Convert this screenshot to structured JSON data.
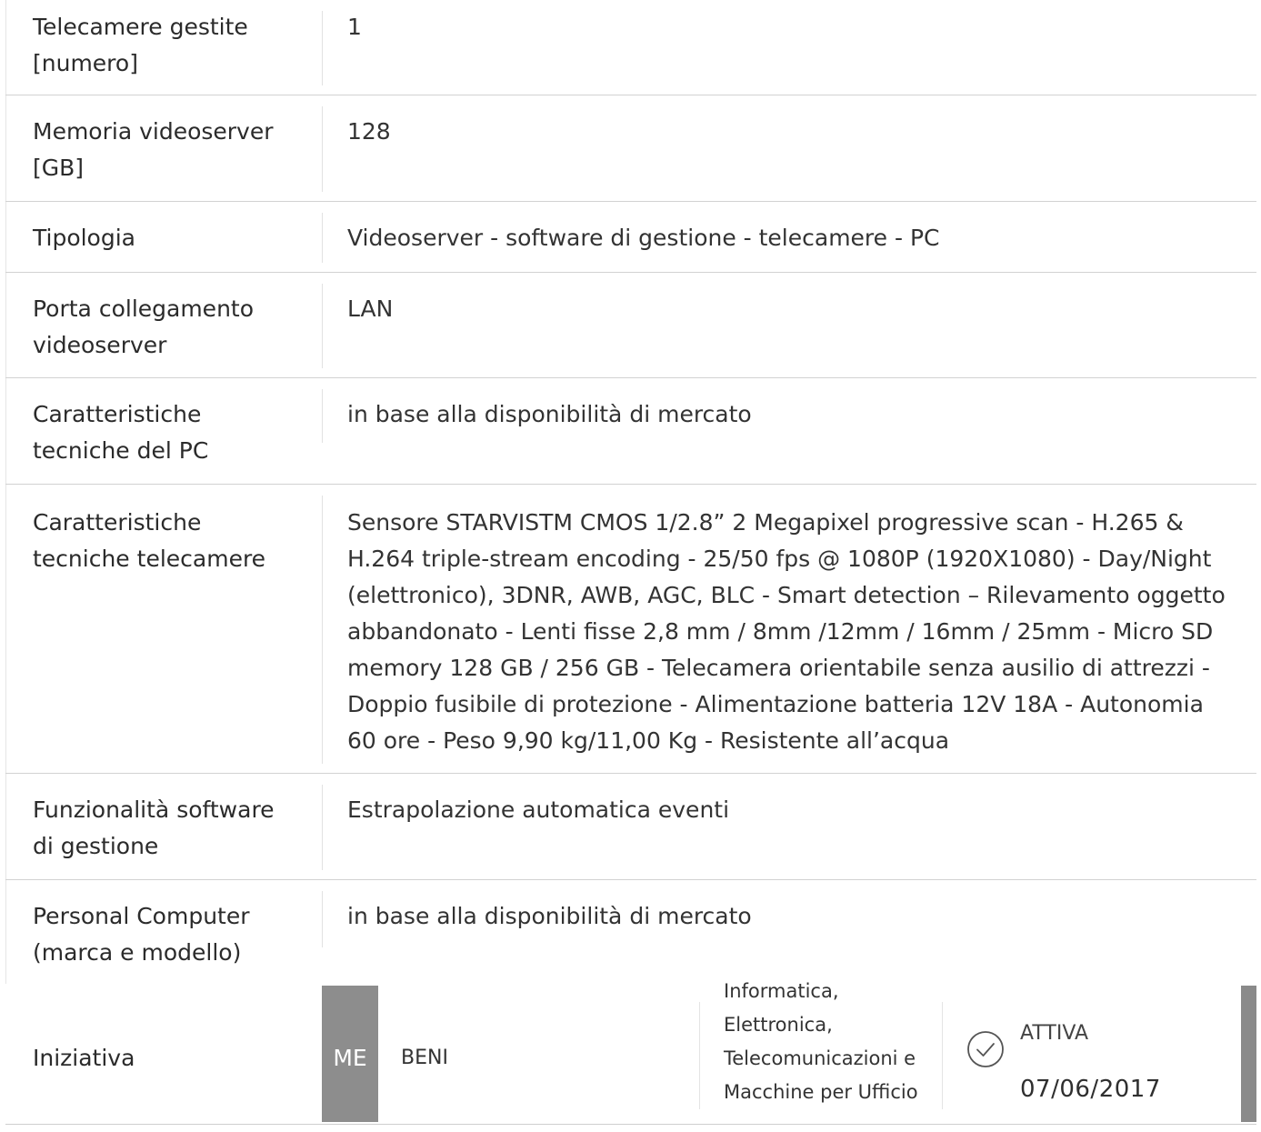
{
  "specs": [
    {
      "label": "Telecamere gestite\n[numero]",
      "value": "1"
    },
    {
      "label": "Memoria videoserver\n[GB]",
      "value": "128"
    },
    {
      "label": "Tipologia",
      "value": "Videoserver - software di gestione - telecamere - PC"
    },
    {
      "label": "Porta collegamento\nvideoserver",
      "value": "LAN"
    },
    {
      "label": "Caratteristiche\ntecniche del PC",
      "value": "in base alla disponibilità di mercato"
    },
    {
      "label": "Caratteristiche\ntecniche telecamere",
      "value": "Sensore STARVISTM CMOS 1/2.8” 2 Megapixel progressive scan - H.265 & H.264 triple-stream encoding - 25/50 fps @ 1080P (1920X1080) - Day/Night (elettronico), 3DNR, AWB, AGC, BLC - Smart detection – Rilevamento oggetto abbandonato - Lenti fisse 2,8 mm / 8mm /12mm / 16mm / 25mm - Micro SD memory 128 GB / 256 GB - Telecamera orientabile senza ausilio di attrezzi - Doppio fusibile di protezione - Alimentazione batteria 12V 18A - Autonomia 60 ore - Peso 9,90 kg/11,00 Kg - Resistente all’acqua"
    },
    {
      "label": "Funzionalità software\ndi gestione",
      "value": "Estrapolazione automatica eventi"
    },
    {
      "label": "Personal Computer\n(marca e modello)",
      "value": "in base alla disponibilità di mercato"
    }
  ],
  "iniziativa": {
    "label": "Iniziativa",
    "badge": "ME",
    "type": "BENI",
    "category": "Informatica, Elettronica, Telecomunicazioni e Macchine per Ufficio",
    "status_icon": "check-circle-icon",
    "status": "ATTIVA",
    "date": "07/06/2017"
  }
}
